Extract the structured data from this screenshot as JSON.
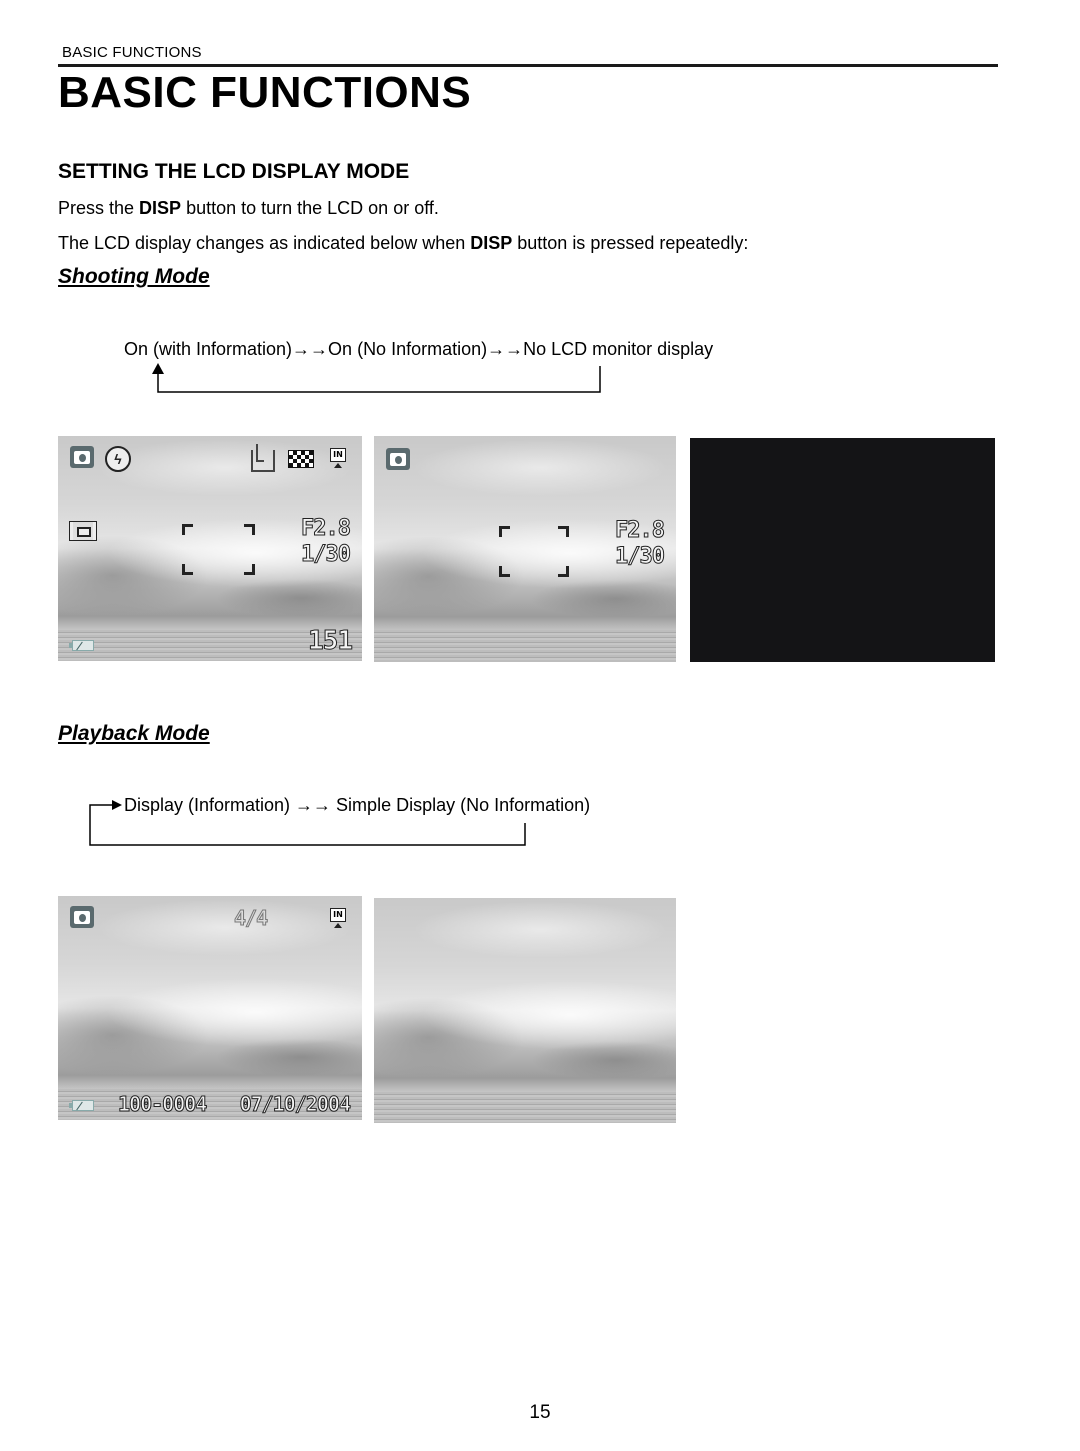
{
  "header": {
    "running_head": "BASIC FUNCTIONS",
    "title": "BASIC FUNCTIONS"
  },
  "section": {
    "title": "SETTING THE LCD DISPLAY MODE",
    "para1": {
      "pre": "Press the ",
      "bold": "DISP",
      "post": " button to turn the LCD on or off."
    },
    "para2": {
      "pre": "The LCD display changes as indicated below when ",
      "bold": "DISP",
      "post": " button is pressed repeatedly:"
    }
  },
  "shooting_mode": {
    "title": "Shooting Mode",
    "flow_text": "On (with Information)→→On (No Information)→→No LCD monitor display",
    "screens": [
      {
        "label": "On (with Information)",
        "icons": [
          "camera-mode-icon",
          "flash-off-icon",
          "image-size-icon",
          "quality-icon",
          "internal-memory-icon",
          "af-area-icon",
          "battery-icon"
        ],
        "aperture": "F2.8",
        "shutter": "1/30",
        "shots_remaining": "151"
      },
      {
        "label": "On (No Information)",
        "icons": [
          "camera-mode-icon"
        ],
        "aperture": "F2.8",
        "shutter": "1/30"
      },
      {
        "label": "No LCD monitor display"
      }
    ]
  },
  "playback_mode": {
    "title": "Playback Mode",
    "flow_text": "Display (Information) →→ Simple Display (No Information)",
    "screens": [
      {
        "label": "Display (Information)",
        "icons": [
          "camera-mode-icon",
          "internal-memory-icon",
          "battery-icon"
        ],
        "frame_counter": "4/4",
        "file_number": "100-0004",
        "date": "07/10/2004"
      },
      {
        "label": "Simple Display (No Information)"
      }
    ]
  },
  "footer": {
    "page_number": "15"
  }
}
